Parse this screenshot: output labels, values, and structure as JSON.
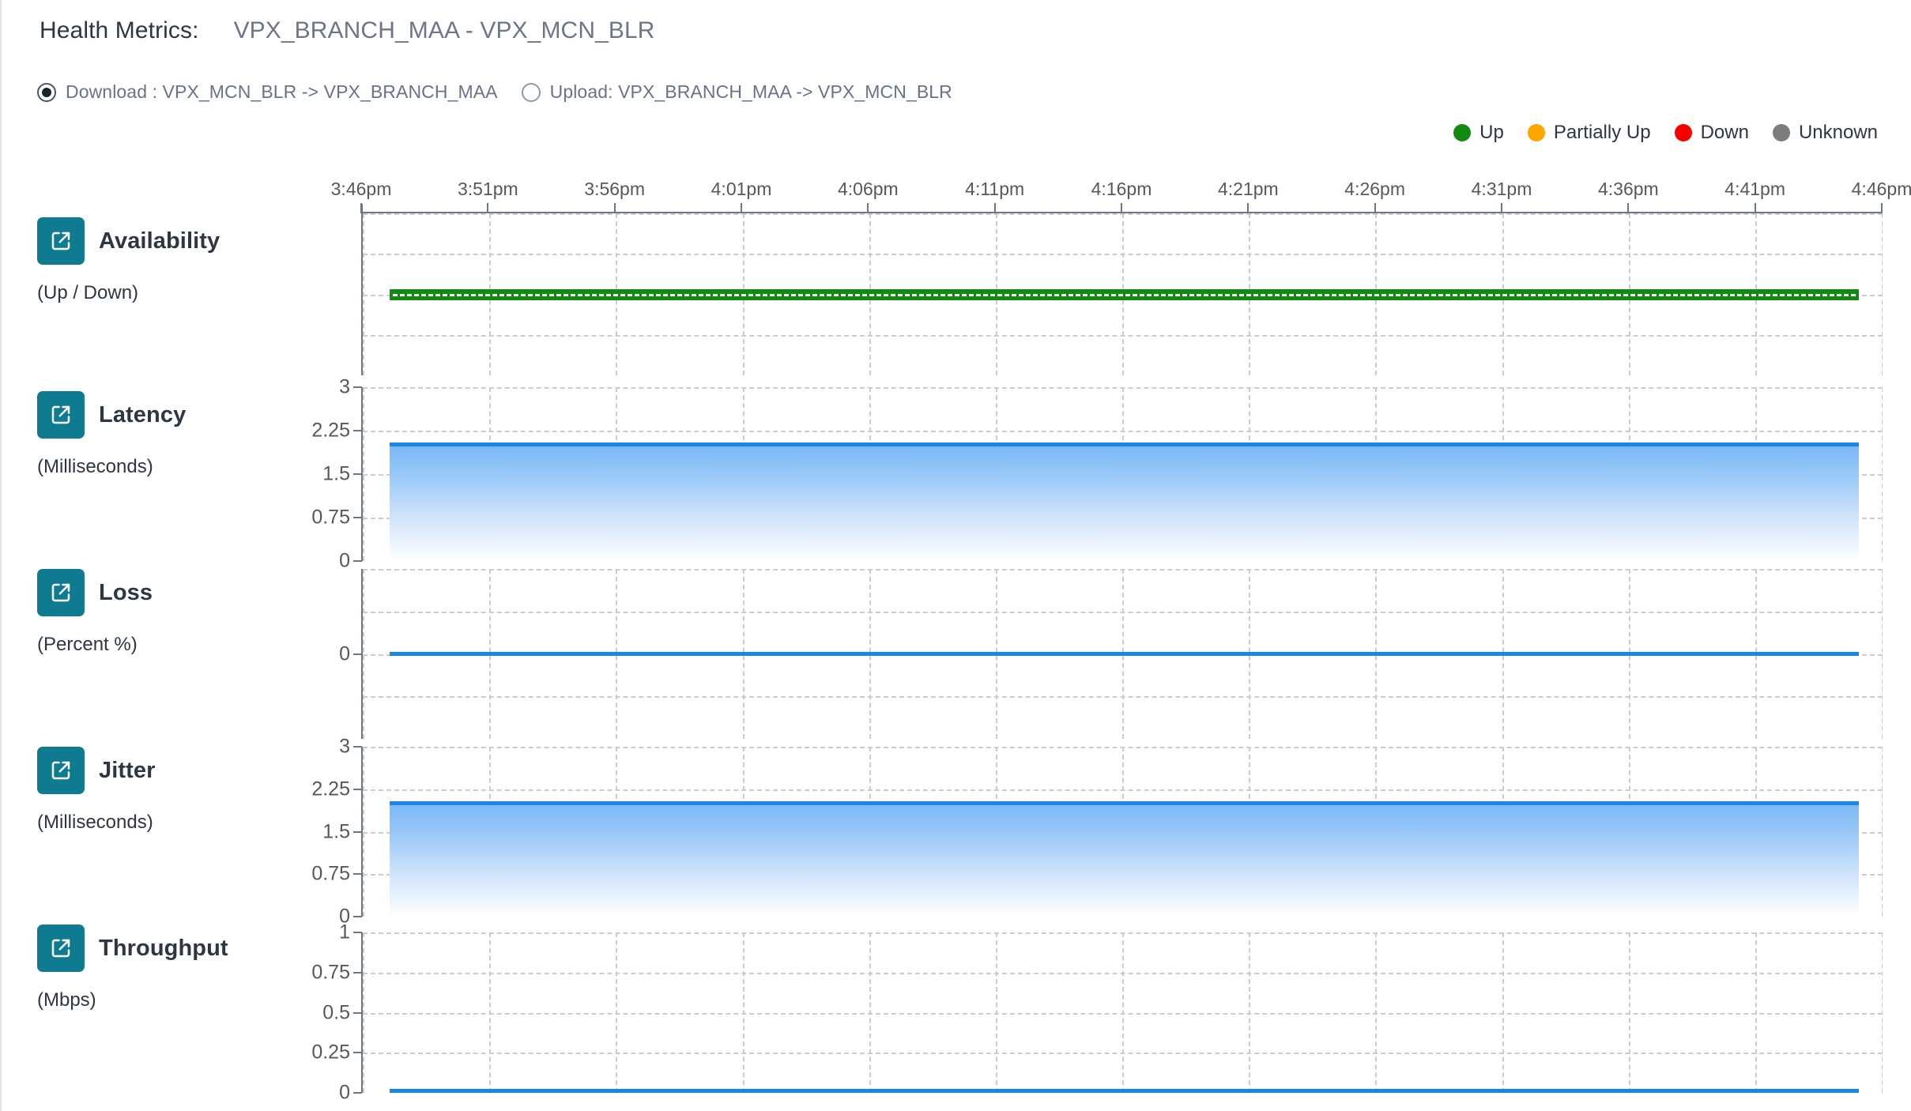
{
  "header": {
    "label": "Health Metrics:",
    "value": "VPX_BRANCH_MAA - VPX_MCN_BLR"
  },
  "direction_selector": {
    "options": [
      {
        "id": "download",
        "label": "Download : VPX_MCN_BLR -> VPX_BRANCH_MAA",
        "selected": true
      },
      {
        "id": "upload",
        "label": "Upload: VPX_BRANCH_MAA -> VPX_MCN_BLR",
        "selected": false
      }
    ]
  },
  "legend": {
    "items": [
      {
        "label": "Up",
        "color": "#128a12"
      },
      {
        "label": "Partially Up",
        "color": "#ffa500"
      },
      {
        "label": "Down",
        "color": "#f60000"
      },
      {
        "label": "Unknown",
        "color": "#7c7c7c"
      }
    ]
  },
  "metrics": [
    {
      "title": "Availability",
      "unit": "(Up / Down)",
      "icon": "external-link-icon"
    },
    {
      "title": "Latency",
      "unit": "(Milliseconds)",
      "icon": "external-link-icon"
    },
    {
      "title": "Loss",
      "unit": "(Percent %)",
      "icon": "external-link-icon"
    },
    {
      "title": "Jitter",
      "unit": "(Milliseconds)",
      "icon": "external-link-icon"
    },
    {
      "title": "Throughput",
      "unit": "(Mbps)",
      "icon": "external-link-icon"
    }
  ],
  "colors": {
    "accent_teal": "#0f7b91",
    "series_blue": "#1a86e8",
    "up_green": "#128a12",
    "grid": "#c9cdd2",
    "axis": "#6e7681"
  },
  "chart_data": [
    {
      "type": "line",
      "title": "Availability",
      "ylabel": "(Up / Down)",
      "xlabel": "",
      "x": [
        "3:46pm",
        "3:51pm",
        "3:56pm",
        "4:01pm",
        "4:06pm",
        "4:11pm",
        "4:16pm",
        "4:21pm",
        "4:26pm",
        "4:31pm",
        "4:36pm",
        "4:41pm",
        "4:46pm"
      ],
      "yticks": [],
      "ylim": [
        0,
        1
      ],
      "grid": true,
      "legend": [
        "Up",
        "Partially Up",
        "Down",
        "Unknown"
      ],
      "series": [
        {
          "name": "Up",
          "color": "#128a12",
          "values": [
            1,
            1,
            1,
            1,
            1,
            1,
            1,
            1,
            1,
            1,
            1,
            1,
            1
          ]
        }
      ],
      "note": "Status bar constant at Up for the full window"
    },
    {
      "type": "area",
      "title": "Latency",
      "ylabel": "(Milliseconds)",
      "xlabel": "",
      "x": [
        "3:46pm",
        "3:51pm",
        "3:56pm",
        "4:01pm",
        "4:06pm",
        "4:11pm",
        "4:16pm",
        "4:21pm",
        "4:26pm",
        "4:31pm",
        "4:36pm",
        "4:41pm",
        "4:46pm"
      ],
      "yticks": [
        0,
        0.75,
        1.5,
        2.25,
        3
      ],
      "ytick_labels": [
        "0",
        "0.75",
        "1.5",
        "2.25",
        "3"
      ],
      "ylim": [
        0,
        3
      ],
      "grid": true,
      "series": [
        {
          "name": "Latency",
          "color": "#1a86e8",
          "values": [
            2.0,
            2.0,
            2.0,
            2.0,
            2.0,
            2.0,
            2.0,
            2.0,
            2.0,
            2.0,
            2.0,
            2.0,
            2.0
          ]
        }
      ]
    },
    {
      "type": "line",
      "title": "Loss",
      "ylabel": "(Percent %)",
      "xlabel": "",
      "x": [
        "3:46pm",
        "3:51pm",
        "3:56pm",
        "4:01pm",
        "4:06pm",
        "4:11pm",
        "4:16pm",
        "4:21pm",
        "4:26pm",
        "4:31pm",
        "4:36pm",
        "4:41pm",
        "4:46pm"
      ],
      "yticks": [
        0
      ],
      "ytick_labels": [
        "0"
      ],
      "ylim": [
        -1,
        1
      ],
      "grid": true,
      "series": [
        {
          "name": "Loss",
          "color": "#1a86e8",
          "values": [
            0,
            0,
            0,
            0,
            0,
            0,
            0,
            0,
            0,
            0,
            0,
            0,
            0
          ]
        }
      ]
    },
    {
      "type": "area",
      "title": "Jitter",
      "ylabel": "(Milliseconds)",
      "xlabel": "",
      "x": [
        "3:46pm",
        "3:51pm",
        "3:56pm",
        "4:01pm",
        "4:06pm",
        "4:11pm",
        "4:16pm",
        "4:21pm",
        "4:26pm",
        "4:31pm",
        "4:36pm",
        "4:41pm",
        "4:46pm"
      ],
      "yticks": [
        0,
        0.75,
        1.5,
        2.25,
        3
      ],
      "ytick_labels": [
        "0",
        "0.75",
        "1.5",
        "2.25",
        "3"
      ],
      "ylim": [
        0,
        3
      ],
      "grid": true,
      "series": [
        {
          "name": "Jitter",
          "color": "#1a86e8",
          "values": [
            2.0,
            2.0,
            2.0,
            2.0,
            2.0,
            2.0,
            2.0,
            2.0,
            2.0,
            2.0,
            2.0,
            2.0,
            2.0
          ]
        }
      ]
    },
    {
      "type": "line",
      "title": "Throughput",
      "ylabel": "(Mbps)",
      "xlabel": "",
      "x": [
        "3:46pm",
        "3:51pm",
        "3:56pm",
        "4:01pm",
        "4:06pm",
        "4:11pm",
        "4:16pm",
        "4:21pm",
        "4:26pm",
        "4:31pm",
        "4:36pm",
        "4:41pm",
        "4:46pm"
      ],
      "yticks": [
        0,
        0.25,
        0.5,
        0.75,
        1
      ],
      "ytick_labels": [
        "0",
        "0.25",
        "0.5",
        "0.75",
        "1"
      ],
      "ylim": [
        0,
        1
      ],
      "grid": true,
      "series": [
        {
          "name": "Throughput",
          "color": "#1a86e8",
          "values": [
            0.01,
            0.01,
            0.01,
            0.01,
            0.01,
            0.01,
            0.01,
            0.01,
            0.01,
            0.01,
            0.01,
            0.01,
            0.01
          ]
        }
      ]
    }
  ]
}
